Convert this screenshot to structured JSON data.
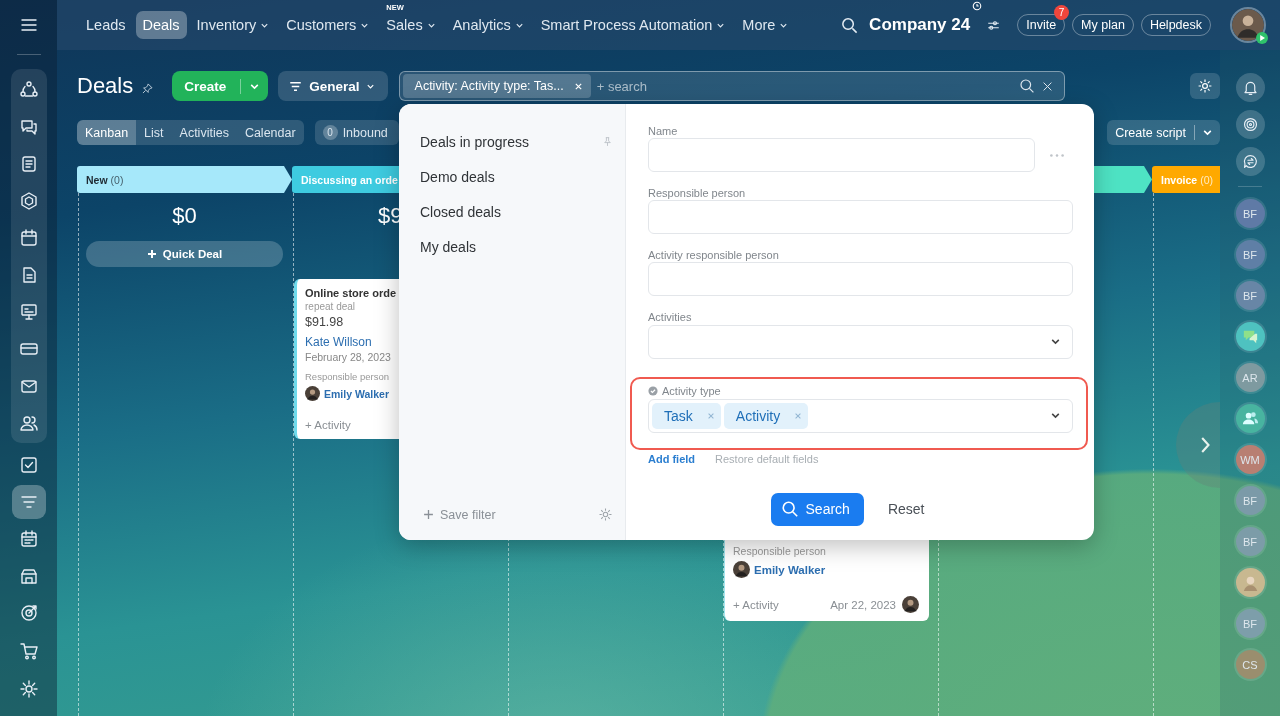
{
  "sidebar": {
    "group": [
      {
        "kind": "network",
        "selected": false
      },
      {
        "kind": "chat",
        "selected": false
      },
      {
        "kind": "document",
        "selected": false
      },
      {
        "kind": "hexagon",
        "selected": false
      },
      {
        "kind": "calendar",
        "selected": false
      },
      {
        "kind": "file",
        "selected": false
      },
      {
        "kind": "presentation",
        "selected": false
      },
      {
        "kind": "card",
        "selected": false
      },
      {
        "kind": "mail",
        "selected": false
      },
      {
        "kind": "contacts",
        "selected": false
      }
    ],
    "items": [
      {
        "kind": "checkbox",
        "selected": false
      },
      {
        "kind": "filter",
        "selected": true
      },
      {
        "kind": "schedule",
        "selected": false
      },
      {
        "kind": "store",
        "selected": false
      },
      {
        "kind": "target",
        "selected": false
      },
      {
        "kind": "cart",
        "selected": false
      },
      {
        "kind": "settings",
        "selected": false
      }
    ]
  },
  "top_nav": {
    "items": [
      {
        "label": "Leads",
        "selected": false,
        "dropdown": false
      },
      {
        "label": "Deals",
        "selected": true,
        "dropdown": false
      },
      {
        "label": "Inventory",
        "selected": false,
        "dropdown": true
      },
      {
        "label": "Customers",
        "selected": false,
        "dropdown": true
      },
      {
        "label": "Sales",
        "selected": false,
        "dropdown": true,
        "badge": "NEW"
      },
      {
        "label": "Analytics",
        "selected": false,
        "dropdown": true
      },
      {
        "label": "Smart Process Automation",
        "selected": false,
        "dropdown": true
      },
      {
        "label": "More",
        "selected": false,
        "dropdown": true
      }
    ],
    "company": "Company 24",
    "invite": {
      "label": "Invite",
      "count": "7"
    },
    "buttons": [
      "My plan",
      "Helpdesk"
    ]
  },
  "page": {
    "title": "Deals",
    "create": "Create",
    "category": "General",
    "filter": {
      "tag": "Activity: Activity type: Tas...",
      "placeholder": "+ search"
    }
  },
  "views": [
    {
      "label": "Kanban",
      "selected": true
    },
    {
      "label": "List",
      "selected": false
    },
    {
      "label": "Activities",
      "selected": false
    },
    {
      "label": "Calendar",
      "selected": false
    }
  ],
  "inbound": {
    "count": "0",
    "label": "Inbound"
  },
  "create_script": "Create script",
  "columns": [
    {
      "title": "New",
      "count": "(0)",
      "color": "#a6e8fa",
      "total": "$0",
      "quick_deal": "Quick Deal"
    },
    {
      "title": "Discussing an orde",
      "color": "#3ecbe0",
      "total": "$9",
      "cards": [
        {
          "title": "Online store orde",
          "subtitle": "repeat deal",
          "amount": "$91.98",
          "contact": "Kate Willson",
          "date": "February 28, 2023",
          "responsible_label": "Responsible person",
          "responsible": "Emily Walker",
          "activity": "+ Activity"
        }
      ]
    },
    {},
    {
      "cards": [
        {
          "responsible_label": "Responsible person",
          "responsible": "Emily Walker",
          "activity": "+ Activity",
          "due": "Apr 22, 2023"
        }
      ]
    },
    {
      "color": "#4ee3c4"
    },
    {
      "title": "Invoice",
      "count": "(0)",
      "color": "#ffa900"
    }
  ],
  "filter_popup": {
    "presets": [
      {
        "label": "Deals in progress",
        "pinned": true
      },
      {
        "label": "Demo deals",
        "pinned": false
      },
      {
        "label": "Closed deals",
        "pinned": false
      },
      {
        "label": "My deals",
        "pinned": false
      }
    ],
    "save_filter": "Save filter",
    "fields": [
      {
        "label": "Name",
        "kind": "text"
      },
      {
        "label": "Responsible person",
        "kind": "text"
      },
      {
        "label": "Activity responsible person",
        "kind": "text"
      },
      {
        "label": "Activities",
        "kind": "select"
      },
      {
        "label": "Activity type",
        "kind": "tags",
        "highlighted": true,
        "tags": [
          "Task",
          "Activity"
        ]
      }
    ],
    "add_field": "Add field",
    "restore": "Restore default fields",
    "search": "Search",
    "reset": "Reset"
  },
  "rail": {
    "tools": [
      {
        "kind": "bell"
      },
      {
        "kind": "spiral"
      },
      {
        "kind": "chat"
      }
    ],
    "contacts": [
      {
        "kind": "initials",
        "initials": "BF",
        "color": "#5f7aa6"
      },
      {
        "kind": "initials",
        "initials": "BF",
        "color": "#5f7fa6"
      },
      {
        "kind": "initials",
        "initials": "BF",
        "color": "#6886a6"
      },
      {
        "kind": "chat",
        "color": "#4ec2c0"
      },
      {
        "kind": "initials",
        "initials": "AR",
        "color": "#7e9aa0"
      },
      {
        "kind": "group",
        "color": "#48b4a0"
      },
      {
        "kind": "initials",
        "initials": "WM",
        "color": "#b87f72"
      },
      {
        "kind": "initials",
        "initials": "BF",
        "color": "#7b9aa8"
      },
      {
        "kind": "initials",
        "initials": "BF",
        "color": "#7c9ca8"
      },
      {
        "kind": "photo",
        "color": "#c8b890"
      },
      {
        "kind": "initials",
        "initials": "BF",
        "color": "#7d9eaa"
      },
      {
        "kind": "initials",
        "initials": "CS",
        "color": "#9a8e6e"
      }
    ]
  }
}
